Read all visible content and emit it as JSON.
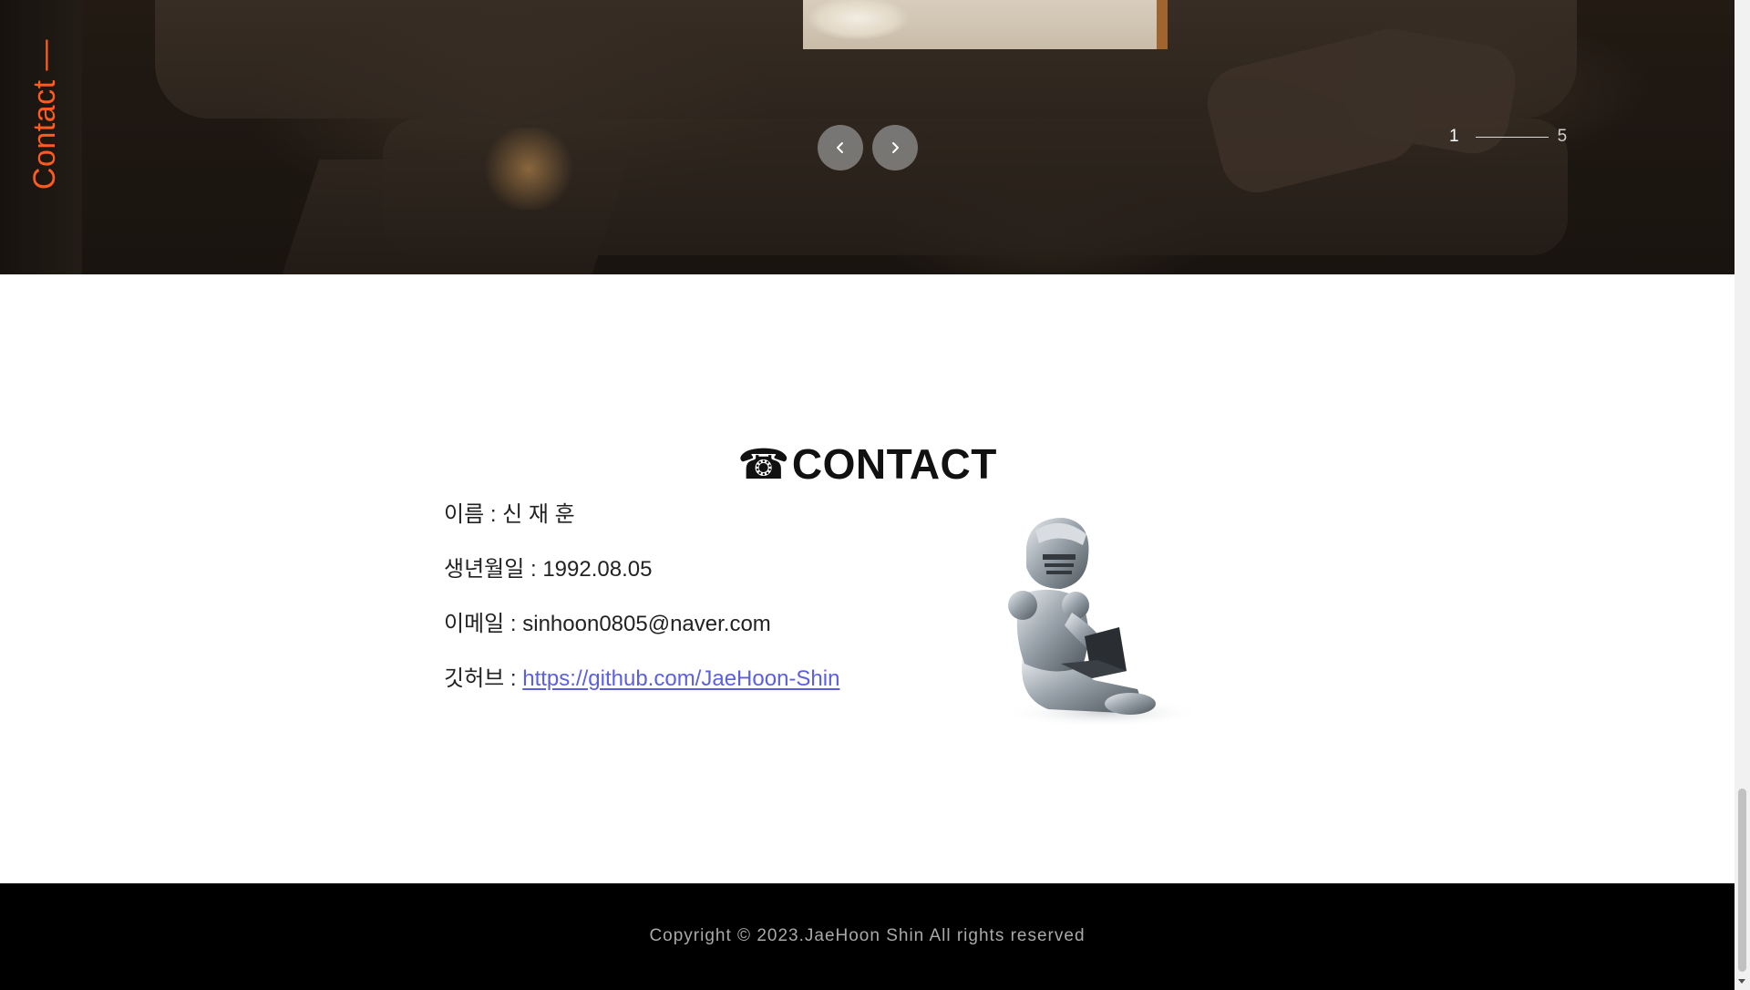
{
  "hero": {
    "side_label": "Contact —",
    "pager": {
      "current": "1",
      "total": "5"
    }
  },
  "contact": {
    "title_icon": "☎",
    "title": "CONTACT",
    "rows": [
      {
        "label": "이름 : ",
        "value": "신 재 훈"
      },
      {
        "label": "생년월일 : ",
        "value": "1992.08.05"
      },
      {
        "label": "이메일 : ",
        "value": "sinhoon0805@naver.com"
      },
      {
        "label": "깃허브 : ",
        "value": "https://github.com/JaeHoon-Shin"
      }
    ],
    "link_color": "#5b5fe0"
  },
  "footer": {
    "copyright": "Copyright © 2023.JaeHoon Shin All rights reserved"
  },
  "colors": {
    "accent": "#ff5a1f",
    "footer_bg": "#000000"
  },
  "icons": {
    "prev": "chevron-left-icon",
    "next": "chevron-right-icon",
    "phone": "telephone-icon",
    "illustration": "knight-laptop-icon"
  }
}
